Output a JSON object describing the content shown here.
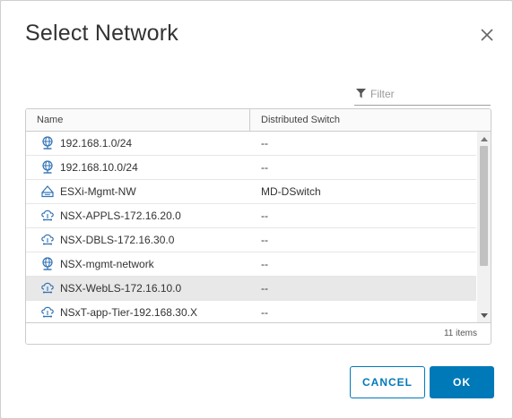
{
  "dialog": {
    "title": "Select Network",
    "close_icon": "close-icon"
  },
  "filter": {
    "icon": "filter-icon",
    "placeholder": "Filter",
    "value": ""
  },
  "table": {
    "columns": [
      "Name",
      "Distributed Switch"
    ],
    "rows": [
      {
        "icon": "network-globe-icon",
        "name": "192.168.1.0/24",
        "switch": "--",
        "selected": false
      },
      {
        "icon": "network-globe-icon",
        "name": "192.168.10.0/24",
        "switch": "--",
        "selected": false
      },
      {
        "icon": "distributed-portgroup-icon",
        "name": "ESXi-Mgmt-NW",
        "switch": "MD-DSwitch",
        "selected": false
      },
      {
        "icon": "nsx-segment-icon",
        "name": "NSX-APPLS-172.16.20.0",
        "switch": "--",
        "selected": false
      },
      {
        "icon": "nsx-segment-icon",
        "name": "NSX-DBLS-172.16.30.0",
        "switch": "--",
        "selected": false
      },
      {
        "icon": "network-globe-icon",
        "name": "NSX-mgmt-network",
        "switch": "--",
        "selected": false
      },
      {
        "icon": "nsx-segment-icon",
        "name": "NSX-WebLS-172.16.10.0",
        "switch": "--",
        "selected": true
      },
      {
        "icon": "nsx-segment-icon",
        "name": "NSxT-app-Tier-192.168.30.X",
        "switch": "--",
        "selected": false
      }
    ],
    "footer": "11 items"
  },
  "buttons": {
    "cancel": "CANCEL",
    "ok": "OK"
  },
  "colors": {
    "accent": "#0079b8",
    "selected_row": "#e8e8e8",
    "icon": "#2f72b5"
  }
}
